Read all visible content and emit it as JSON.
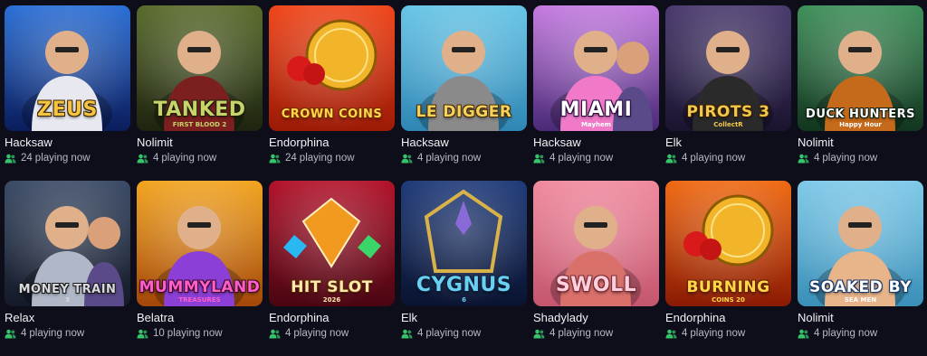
{
  "games": [
    {
      "title": "ZEUS",
      "subtitle": "",
      "provider": "Hacksaw",
      "players": "24",
      "playing_label": "playing now",
      "bg": [
        "#2b6fd6",
        "#0b1d5c"
      ],
      "title_color": "#f5c542",
      "title_stroke": "#3b2300",
      "art": "figure-zeus",
      "accent": "#e8e8f0"
    },
    {
      "title": "TANKED",
      "subtitle": "FIRST BLOOD 2",
      "provider": "Nolimit",
      "players": "4",
      "playing_label": "playing now",
      "bg": [
        "#5a6b2c",
        "#1d2410"
      ],
      "title_color": "#c8d36a",
      "title_stroke": "#1b1e08",
      "art": "figure-soldier",
      "accent": "#7c1f1f"
    },
    {
      "title": "CROWN COINS",
      "subtitle": "",
      "provider": "Endorphina",
      "players": "24",
      "playing_label": "playing now",
      "bg": [
        "#f0461a",
        "#9c1a06"
      ],
      "title_color": "#ffd84a",
      "title_stroke": "#7a2a00",
      "art": "coin",
      "accent": "#f2b52a"
    },
    {
      "title": "LE DIGGER",
      "subtitle": "",
      "provider": "Hacksaw",
      "players": "4",
      "playing_label": "playing now",
      "bg": [
        "#68c5e6",
        "#2f86b4"
      ],
      "title_color": "#f4d35a",
      "title_stroke": "#4a2a05",
      "art": "figure-raccoon",
      "accent": "#8a8a8a"
    },
    {
      "title": "MIAMI",
      "subtitle": "Mayhem",
      "provider": "Hacksaw",
      "players": "4",
      "playing_label": "playing now",
      "bg": [
        "#c47be0",
        "#4a2a78"
      ],
      "title_color": "#ffffff",
      "title_stroke": "#2a0a40",
      "art": "figure-duo",
      "accent": "#f07ac8"
    },
    {
      "title": "PIROTS 3",
      "subtitle": "CollectR",
      "provider": "Elk",
      "players": "4",
      "playing_label": "playing now",
      "bg": [
        "#4a3a6e",
        "#1b1430"
      ],
      "title_color": "#f2c94c",
      "title_stroke": "#3a1f00",
      "art": "figure-bird",
      "accent": "#2a2a2a"
    },
    {
      "title": "DUCK HUNTERS",
      "subtitle": "Happy Hour",
      "provider": "Nolimit",
      "players": "4",
      "playing_label": "playing now",
      "bg": [
        "#3f8f5a",
        "#12361f"
      ],
      "title_color": "#ffffff",
      "title_stroke": "#0b1f12",
      "art": "figure-duck",
      "accent": "#c46a1a"
    },
    {
      "title": "MONEY TRAIN",
      "subtitle": "3",
      "provider": "Relax",
      "players": "4",
      "playing_label": "playing now",
      "bg": [
        "#3b4a66",
        "#141a28"
      ],
      "title_color": "#d9d9e0",
      "title_stroke": "#1a1a1a",
      "art": "figure-duo-dark",
      "accent": "#b0b8c8"
    },
    {
      "title": "MUMMYLAND",
      "subtitle": "TREASURES",
      "provider": "Belatra",
      "players": "10",
      "playing_label": "playing now",
      "bg": [
        "#f2a41f",
        "#a3470a"
      ],
      "title_color": "#ff5ec8",
      "title_stroke": "#3a0a2a",
      "art": "figure-mummy",
      "accent": "#8b3fd6"
    },
    {
      "title": "HIT SLOT",
      "subtitle": "2026",
      "provider": "Endorphina",
      "players": "4",
      "playing_label": "playing now",
      "bg": [
        "#b3122a",
        "#4a0612"
      ],
      "title_color": "#ffe8b0",
      "title_stroke": "#5a2a00",
      "art": "gem",
      "accent": "#f29a1f"
    },
    {
      "title": "CYGNUS",
      "subtitle": "6",
      "provider": "Elk",
      "players": "4",
      "playing_label": "playing now",
      "bg": [
        "#1f3b7a",
        "#0a1330"
      ],
      "title_color": "#6ad0f2",
      "title_stroke": "#0a1f3a",
      "art": "emblem",
      "accent": "#d9b24a"
    },
    {
      "title": "SWOLL",
      "subtitle": "",
      "provider": "Shadylady",
      "players": "4",
      "playing_label": "playing now",
      "bg": [
        "#f08a9e",
        "#c4566e"
      ],
      "title_color": "#ffd0dc",
      "title_stroke": "#7a2a3a",
      "art": "figure-strong",
      "accent": "#d9706a"
    },
    {
      "title": "BURNING",
      "subtitle": "COINS 20",
      "provider": "Endorphina",
      "players": "4",
      "playing_label": "playing now",
      "bg": [
        "#f06a12",
        "#8a1a04"
      ],
      "title_color": "#ffd84a",
      "title_stroke": "#6a2000",
      "art": "coin",
      "accent": "#f2b52a"
    },
    {
      "title": "SOAKED BY",
      "subtitle": "SEA MEN",
      "provider": "Nolimit",
      "players": "4",
      "playing_label": "playing now",
      "bg": [
        "#7fc9e8",
        "#3a8fb8"
      ],
      "title_color": "#ffffff",
      "title_stroke": "#1a3a6a",
      "art": "figure-sailor",
      "accent": "#e8b48a"
    }
  ]
}
